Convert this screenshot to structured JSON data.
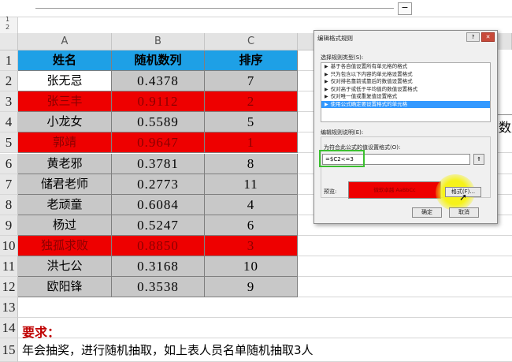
{
  "formula_bar": {
    "collapse_glyph": "−"
  },
  "outline_levels": [
    "1",
    "2"
  ],
  "columns": [
    "A",
    "B",
    "C"
  ],
  "table": {
    "headers": [
      "姓名",
      "随机数列",
      "排序"
    ],
    "rows": [
      {
        "name": "张无忌",
        "value": "0.4378",
        "rank": "7",
        "highlight": false
      },
      {
        "name": "张三丰",
        "value": "0.9112",
        "rank": "2",
        "highlight": true
      },
      {
        "name": "小龙女",
        "value": "0.5589",
        "rank": "5",
        "highlight": false
      },
      {
        "name": "郭靖",
        "value": "0.9647",
        "rank": "1",
        "highlight": true
      },
      {
        "name": "黄老邪",
        "value": "0.3781",
        "rank": "8",
        "highlight": false
      },
      {
        "name": "储君老师",
        "value": "0.2773",
        "rank": "11",
        "highlight": false
      },
      {
        "name": "老顽童",
        "value": "0.6084",
        "rank": "4",
        "highlight": false
      },
      {
        "name": "杨过",
        "value": "0.5247",
        "rank": "6",
        "highlight": false
      },
      {
        "name": "独孤求败",
        "value": "0.8850",
        "rank": "3",
        "highlight": true
      },
      {
        "name": "洪七公",
        "value": "0.3168",
        "rank": "10",
        "highlight": false
      },
      {
        "name": "欧阳锋",
        "value": "0.3538",
        "rank": "9",
        "highlight": false
      }
    ]
  },
  "row_numbers": [
    "1",
    "2",
    "3",
    "4",
    "5",
    "6",
    "7",
    "8",
    "9",
    "10",
    "11",
    "12",
    "13",
    "14",
    "15"
  ],
  "requirements": {
    "title": "要求：",
    "text": "年会抽奖，进行随机抽取，如上表人员名单随机抽取3人"
  },
  "right_fragment_char": "数",
  "dialog": {
    "title": "编辑格式规则",
    "help_glyph": "?",
    "close_glyph": "✕",
    "rule_type_label": "选择规则类型(S):",
    "rule_types": [
      "基于各自值设置所有单元格的格式",
      "只为包含以下内容的单元格设置格式",
      "仅对排名靠前或靠后的数值设置格式",
      "仅对高于或低于平均值的数值设置格式",
      "仅对唯一值或重复值设置格式",
      "使用公式确定要设置格式的单元格"
    ],
    "selected_rule_index": 5,
    "rule_desc_label": "编辑规则说明(E):",
    "formula_label": "为符合此公式的值设置格式(O):",
    "formula_value": "=$C2<=3",
    "ref_glyph": "⇑",
    "preview_label": "预览:",
    "preview_text": "微软卓越  AaBbCc",
    "format_button": "格式(F)...",
    "ok_button": "确定",
    "cancel_button": "取消"
  },
  "colors": {
    "header_blue": "#1ea0e6",
    "highlight_red": "#ee0000",
    "highlight_text": "#8b0000",
    "gray_cell": "#c8c8c8",
    "requirement_red": "#c00000",
    "selection_blue": "#3399ff"
  }
}
